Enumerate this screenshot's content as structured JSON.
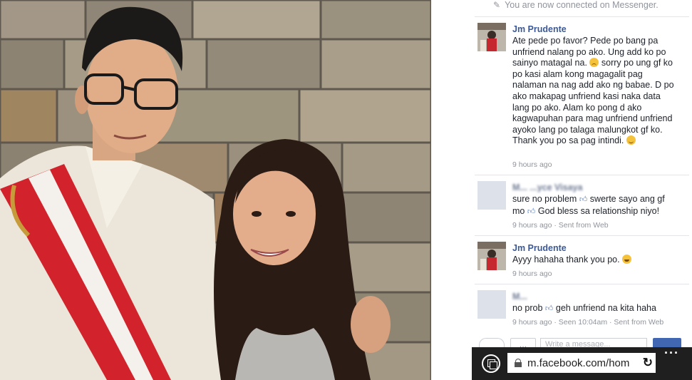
{
  "system_message": "You are now connected on Messenger.",
  "messages": [
    {
      "sender": "Jm Prudente",
      "lines": [
        "Ate pede po favor? Pede po bang pa",
        "unfriend nalang po ako. Ung add ko po",
        "sainyo matagal na.",
        "sorry po ung gf ko",
        "po kasi alam kong magagalit pag",
        "nalaman na nag add ako ng babae. D po",
        "ako makapag unfriend kasi naka data",
        "lang po ako. Alam ko pong d ako",
        "kagwapuhan para mag unfriend unfriend",
        "ayoko lang po talaga malungkot gf ko.",
        "Thank you po sa pag intindi."
      ],
      "time": "9 hours ago"
    },
    {
      "sender": "M... ...yce Visaya",
      "lines": [
        "sure no problem",
        "swerte sayo ang gf",
        "mo",
        "God bless sa relationship niyo!"
      ],
      "time": "9 hours ago · Sent from Web"
    },
    {
      "sender": "Jm Prudente",
      "lines": [
        "Ayyy hahaha thank you po."
      ],
      "time": "9 hours ago"
    },
    {
      "sender": "M...",
      "lines": [
        "no prob",
        "geh unfriend na kita haha"
      ],
      "time": "9 hours ago · Seen 10:04am · Sent from Web"
    }
  ],
  "composer": {
    "placeholder": "Write a message..."
  },
  "browser": {
    "url": "m.facebook.com/hom"
  },
  "icons": {
    "system": "pencil-icon",
    "like": "thumbs-up-icon",
    "tabs": "tabs-icon",
    "lock": "lock-icon",
    "refresh": "refresh-icon",
    "more": "more-icon"
  },
  "colors": {
    "sender_name": "#3b5998",
    "meta_text": "#90949c",
    "browser_bar": "#1f1f1f"
  }
}
